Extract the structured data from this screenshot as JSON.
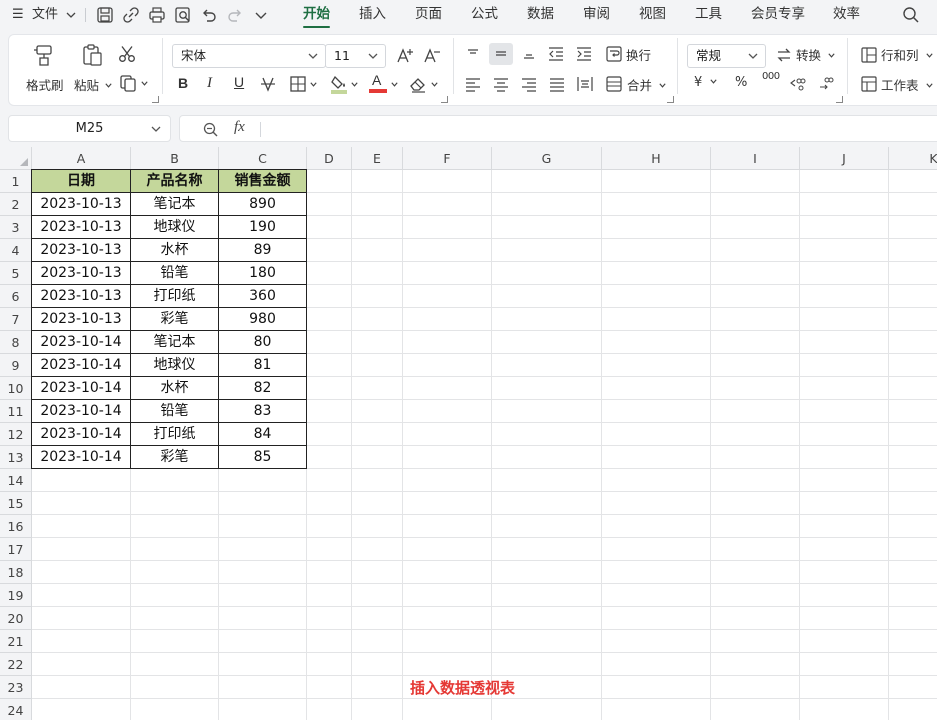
{
  "menubar": {
    "hamburger": "☰",
    "file_label": "文件",
    "tabs": [
      "开始",
      "插入",
      "页面",
      "公式",
      "数据",
      "审阅",
      "视图",
      "工具",
      "会员专享",
      "效率"
    ],
    "active_tab": "开始"
  },
  "ribbon": {
    "format_painter": "格式刷",
    "paste": "粘贴",
    "font_name": "宋体",
    "font_size": "11",
    "wrap": "换行",
    "merge": "合并",
    "number_format": "常规",
    "convert": "转换",
    "rows_cols": "行和列",
    "worksheet": "工作表",
    "bold": "B",
    "italic": "I",
    "underline": "U",
    "font_color_glyph": "A",
    "currency": "¥",
    "percent": "%",
    "thousands": "000"
  },
  "colors": {
    "accent": "#1f6f43",
    "header_fill": "#c4d79b",
    "font_color_bar": "#e53935",
    "fill_color_bar": "#c4d79b",
    "caption": "#e53935"
  },
  "formula_bar": {
    "name_box": "M25",
    "fx": "fx",
    "value": ""
  },
  "sheet": {
    "columns": [
      "A",
      "B",
      "C",
      "D",
      "E",
      "F",
      "G",
      "H",
      "I",
      "J",
      "K"
    ],
    "row_numbers": [
      "1",
      "2",
      "3",
      "4",
      "5",
      "6",
      "7",
      "8",
      "9",
      "10",
      "11",
      "12",
      "13",
      "14",
      "15",
      "16",
      "17",
      "18",
      "19",
      "20",
      "21",
      "22",
      "23",
      "24"
    ],
    "headers": [
      "日期",
      "产品名称",
      "销售金额"
    ],
    "rows": [
      [
        "2023-10-13",
        "笔记本",
        "890"
      ],
      [
        "2023-10-13",
        "地球仪",
        "190"
      ],
      [
        "2023-10-13",
        "水杯",
        "89"
      ],
      [
        "2023-10-13",
        "铅笔",
        "180"
      ],
      [
        "2023-10-13",
        "打印纸",
        "360"
      ],
      [
        "2023-10-13",
        "彩笔",
        "980"
      ],
      [
        "2023-10-14",
        "笔记本",
        "80"
      ],
      [
        "2023-10-14",
        "地球仪",
        "81"
      ],
      [
        "2023-10-14",
        "水杯",
        "82"
      ],
      [
        "2023-10-14",
        "铅笔",
        "83"
      ],
      [
        "2023-10-14",
        "打印纸",
        "84"
      ],
      [
        "2023-10-14",
        "彩笔",
        "85"
      ]
    ]
  },
  "caption": "插入数据透视表"
}
